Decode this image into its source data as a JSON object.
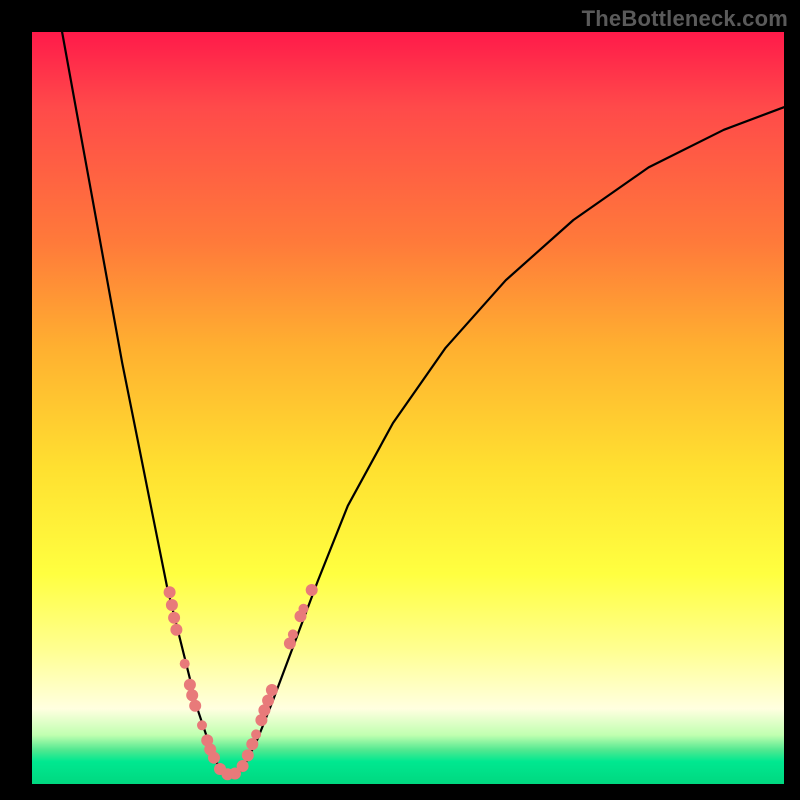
{
  "watermark": "TheBottleneck.com",
  "colors": {
    "background": "#000000",
    "curve": "#000000",
    "dots": "#e87a7a"
  },
  "chart_data": {
    "type": "line",
    "title": "",
    "xlabel": "",
    "ylabel": "",
    "xlim": [
      0,
      100
    ],
    "ylim": [
      0,
      100
    ],
    "grid": false,
    "series": [
      {
        "name": "bottleneck-curve",
        "x": [
          4,
          6,
          8,
          10,
          12,
          14,
          16,
          18,
          20,
          21,
          22,
          23,
          24,
          25,
          26,
          27,
          28,
          30,
          32,
          35,
          38,
          42,
          48,
          55,
          63,
          72,
          82,
          92,
          100
        ],
        "y": [
          100,
          89,
          78,
          67,
          56,
          46,
          36,
          26,
          18,
          14,
          10,
          7,
          4,
          2,
          1,
          1,
          2,
          6,
          11,
          19,
          27,
          37,
          48,
          58,
          67,
          75,
          82,
          87,
          90
        ],
        "note": "V-shaped bottleneck curve; y is bottleneck percentage, minimum ≈0 at x≈25–27"
      }
    ],
    "scatter": {
      "name": "marked-points",
      "points": [
        {
          "x": 18.3,
          "y": 25.5,
          "r": 6
        },
        {
          "x": 18.6,
          "y": 23.8,
          "r": 6
        },
        {
          "x": 18.9,
          "y": 22.1,
          "r": 6
        },
        {
          "x": 19.2,
          "y": 20.5,
          "r": 6
        },
        {
          "x": 20.3,
          "y": 16.0,
          "r": 5
        },
        {
          "x": 21.0,
          "y": 13.2,
          "r": 6
        },
        {
          "x": 21.3,
          "y": 11.8,
          "r": 6
        },
        {
          "x": 21.7,
          "y": 10.4,
          "r": 6
        },
        {
          "x": 22.6,
          "y": 7.8,
          "r": 5
        },
        {
          "x": 23.3,
          "y": 5.8,
          "r": 6
        },
        {
          "x": 23.7,
          "y": 4.6,
          "r": 6
        },
        {
          "x": 24.2,
          "y": 3.5,
          "r": 6
        },
        {
          "x": 25.0,
          "y": 2.0,
          "r": 6
        },
        {
          "x": 26.0,
          "y": 1.3,
          "r": 6
        },
        {
          "x": 27.0,
          "y": 1.4,
          "r": 6
        },
        {
          "x": 28.0,
          "y": 2.4,
          "r": 6
        },
        {
          "x": 28.7,
          "y": 3.8,
          "r": 6
        },
        {
          "x": 29.3,
          "y": 5.3,
          "r": 6
        },
        {
          "x": 29.8,
          "y": 6.6,
          "r": 5
        },
        {
          "x": 30.5,
          "y": 8.5,
          "r": 6
        },
        {
          "x": 30.9,
          "y": 9.8,
          "r": 6
        },
        {
          "x": 31.4,
          "y": 11.1,
          "r": 6
        },
        {
          "x": 31.9,
          "y": 12.5,
          "r": 6
        },
        {
          "x": 34.3,
          "y": 18.7,
          "r": 6
        },
        {
          "x": 34.7,
          "y": 19.9,
          "r": 5
        },
        {
          "x": 35.7,
          "y": 22.3,
          "r": 6
        },
        {
          "x": 36.1,
          "y": 23.3,
          "r": 5
        },
        {
          "x": 37.2,
          "y": 25.8,
          "r": 6
        }
      ]
    }
  }
}
